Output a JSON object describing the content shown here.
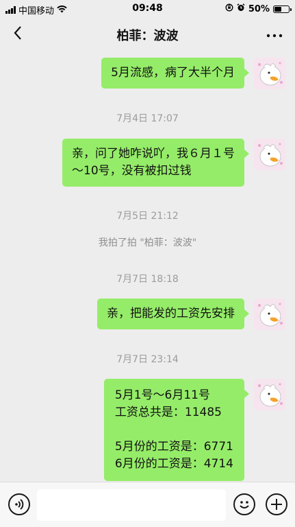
{
  "status_bar": {
    "carrier": "中国移动",
    "time": "09:48",
    "battery": "50%",
    "battery_level": 0.5
  },
  "nav": {
    "title": "柏菲：波波",
    "back_icon": "chevron-left-icon",
    "more_icon": "more-dots-icon"
  },
  "messages": [
    {
      "text": "5月流感，病了大半个月"
    },
    {
      "text": "亲，问了她咋说吖，我６月１号\n～10号，没有被扣过钱"
    },
    {
      "text": "亲，把能发的工资先安排"
    },
    {
      "text": "5月1号～6月11号\n工资总共是：11485\n\n5月份的工资是：6771\n6月份的工资是：4714"
    }
  ],
  "timestamps": [
    "7月4日 17:07",
    "7月5日 21:12",
    "7月7日 18:18",
    "7月7日 23:14"
  ],
  "system_message": "我拍了拍 \"柏菲：波波\"",
  "colors": {
    "bubble": "#95ec69",
    "background": "#ededed",
    "timestamp": "#9b9b9b"
  },
  "input_bar": {
    "voice_icon": "voice-icon",
    "emoji_icon": "emoji-icon",
    "plus_icon": "plus-icon",
    "text_value": ""
  }
}
